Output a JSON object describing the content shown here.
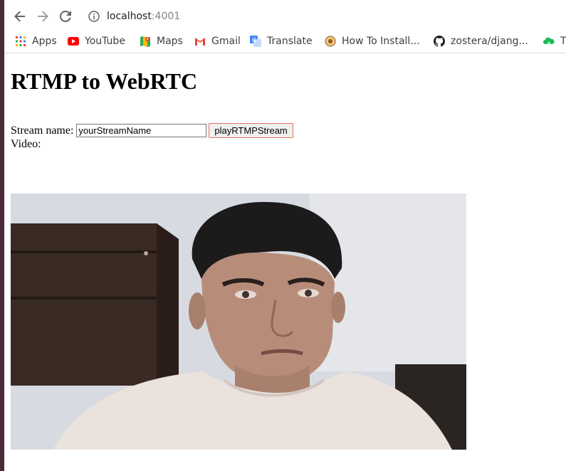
{
  "browser": {
    "url_host": "localhost",
    "url_port": ":4001",
    "bookmarks": [
      {
        "label": "Apps",
        "icon": "apps-grid-icon"
      },
      {
        "label": "YouTube",
        "icon": "youtube-icon"
      },
      {
        "label": "Maps",
        "icon": "maps-icon"
      },
      {
        "label": "Gmail",
        "icon": "gmail-icon"
      },
      {
        "label": "Translate",
        "icon": "translate-icon"
      },
      {
        "label": "How To Install...",
        "icon": "site-favicon-icon"
      },
      {
        "label": "zostera/djang...",
        "icon": "github-icon"
      },
      {
        "label": "T",
        "icon": "cloud-favicon-icon"
      }
    ]
  },
  "page": {
    "title": "RTMP to WebRTC",
    "stream_label": "Stream name:",
    "stream_value": "yourStreamName",
    "play_button": "playRTMPStream",
    "video_label": "Video:"
  },
  "colors": {
    "button_border": "#e07060",
    "youtube_red": "#ff0000",
    "window_bg": "#4a2a3a"
  }
}
